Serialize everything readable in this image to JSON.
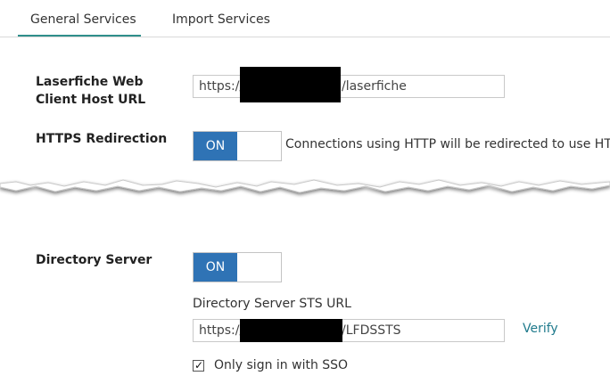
{
  "tabs": {
    "general": "General Services",
    "import": "Import Services"
  },
  "form": {
    "web_client_label": "Laserfiche Web Client Host URL",
    "web_client_prefix": "https://",
    "web_client_suffix": "/laserfiche",
    "https_redirection_label": "HTTPS Redirection",
    "https_toggle_state": "ON",
    "https_help_text": "Connections using HTTP will be redirected to use HTTPS",
    "directory_server_label": "Directory Server",
    "directory_toggle_state": "ON",
    "sts_url_label": "Directory Server STS URL",
    "sts_prefix": "https://",
    "sts_suffix": "/LFDSSTS",
    "verify_label": "Verify",
    "sso_checkbox_label": "Only sign in with SSO",
    "sso_checked": true
  },
  "colors": {
    "accent_tab": "#2f8f8b",
    "toggle_on": "#2f73b5",
    "link": "#1f7a8c"
  },
  "icons": {
    "checkmark": "check-icon"
  }
}
